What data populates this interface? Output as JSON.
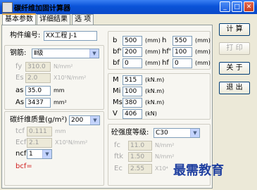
{
  "window": {
    "title": "碳纤维加固计算器"
  },
  "tabs": [
    "基本参数",
    "详细结果",
    "选 项"
  ],
  "component": {
    "label": "构件编号:",
    "value": "XX工程 J-1"
  },
  "rebar": {
    "label": "钢筋:",
    "grade": "Ⅱ级",
    "fy": {
      "label": "fy",
      "value": "310.0",
      "unit": "N/mm²"
    },
    "es": {
      "label": "Es",
      "value": "2.0",
      "unit": "X10⁵N/mm²"
    },
    "as": {
      "label": "as",
      "value": "35.0",
      "unit": "mm"
    },
    "area": {
      "label": "As",
      "value": "3437",
      "unit": "mm²"
    }
  },
  "section": {
    "b": {
      "label": "b",
      "value": "500",
      "unit": "(mm)"
    },
    "h": {
      "label": "h",
      "value": "550",
      "unit": "(mm)"
    },
    "bf1": {
      "label": "bf'",
      "value": "200",
      "unit": "(mm)"
    },
    "hf1": {
      "label": "hf'",
      "value": "100",
      "unit": "(mm)"
    },
    "bf": {
      "label": "bf",
      "value": "0",
      "unit": "(mm)"
    },
    "hf": {
      "label": "hf",
      "value": "0",
      "unit": "(mm)"
    }
  },
  "loads": {
    "m": {
      "label": "M",
      "value": "515",
      "unit": "(kN.m)"
    },
    "mi": {
      "label": "Mi",
      "value": "100",
      "unit": "(kN.m)"
    },
    "ms": {
      "label": "Ms",
      "value": "380",
      "unit": "(kN.m)"
    },
    "v": {
      "label": "V",
      "value": "406",
      "unit": "(kN)"
    }
  },
  "cfrp": {
    "label": "碳纤维质量(g/m²)",
    "mass": "200",
    "tcf": {
      "label": "tcf",
      "value": "0.111",
      "unit": "mm"
    },
    "ecf": {
      "label": "Ecf",
      "value": "2.1",
      "unit": "X10⁵N/mm²"
    },
    "ncf": {
      "label": "ncf",
      "value": "1"
    },
    "bcf": {
      "label": "bcf="
    }
  },
  "concrete": {
    "label": "砼强度等级:",
    "grade": "C30",
    "fc": {
      "label": "fc",
      "value": "11.0",
      "unit": "N/mm²"
    },
    "ftk": {
      "label": "ftk",
      "value": "1.50",
      "unit": "N/mm²"
    },
    "ec": {
      "label": "Ec",
      "value": "2.55",
      "unit": "X10⁴"
    }
  },
  "buttons": {
    "calc": "计 算",
    "print": "打 印",
    "about": "关 于",
    "exit": "退 出"
  },
  "watermark": "最需教育"
}
